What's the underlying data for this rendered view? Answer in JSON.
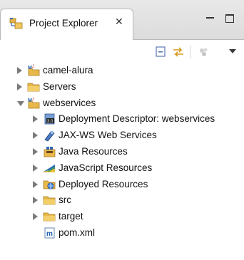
{
  "view": {
    "tab_title": "Project Explorer",
    "tab_close_glyph": "✕",
    "tab_icon": "project-explorer-icon",
    "window_controls": [
      "minimize-icon",
      "maximize-icon"
    ],
    "toolbar": [
      "collapse-all-icon",
      "link-with-editor-icon",
      "filter-icon",
      "view-menu-icon"
    ]
  },
  "tree": {
    "items": [
      {
        "label": "camel-alura",
        "level": 0,
        "state": "closed",
        "icon": "maven-project-icon"
      },
      {
        "label": "Servers",
        "level": 0,
        "state": "closed",
        "icon": "folder-icon"
      },
      {
        "label": "webservices",
        "level": 0,
        "state": "open",
        "icon": "maven-project-icon"
      },
      {
        "label": "Deployment Descriptor: webservices",
        "level": 1,
        "state": "closed",
        "icon": "deployment-descriptor-icon"
      },
      {
        "label": "JAX-WS Web Services",
        "level": 1,
        "state": "closed",
        "icon": "jaxws-icon"
      },
      {
        "label": "Java Resources",
        "level": 1,
        "state": "closed",
        "icon": "java-resources-icon"
      },
      {
        "label": "JavaScript Resources",
        "level": 1,
        "state": "closed",
        "icon": "javascript-resources-icon"
      },
      {
        "label": "Deployed Resources",
        "level": 1,
        "state": "closed",
        "icon": "deployed-resources-icon"
      },
      {
        "label": "src",
        "level": 1,
        "state": "closed",
        "icon": "folder-icon"
      },
      {
        "label": "target",
        "level": 1,
        "state": "closed",
        "icon": "folder-icon"
      },
      {
        "label": "pom.xml",
        "level": 1,
        "state": "leaf",
        "icon": "maven-pom-icon"
      }
    ]
  },
  "colors": {
    "tab_bar": "#dcdcdc",
    "twisty": "#7b7b7b",
    "folder": "#e8b84a",
    "maven_m": "#1f5fb0"
  }
}
